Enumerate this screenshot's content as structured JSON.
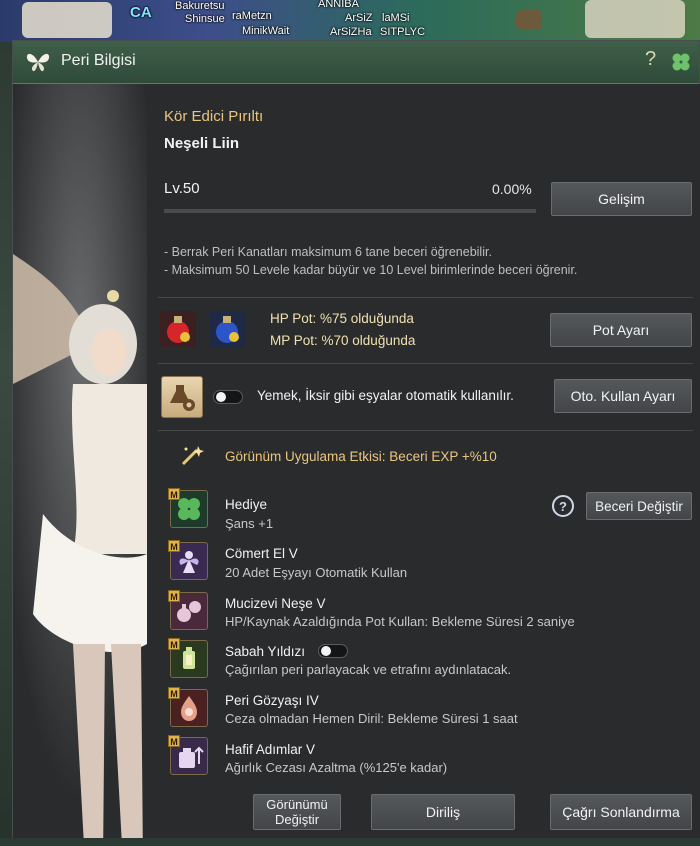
{
  "background": {
    "player_tags": [
      "Bakuretsu",
      "Shinsue",
      "raMetzn",
      "ANNIBA",
      "ArSiZ",
      "laMSi",
      "MinikWait",
      "ArSiZHa",
      "SITPLYC"
    ],
    "guild_tag": "CA"
  },
  "window": {
    "title": "Peri Bilgisi",
    "help_label": "?"
  },
  "peri": {
    "skill_name": "Kör Edici Pırıltı",
    "name": "Neşeli Liin",
    "level": "Lv.50",
    "progress_text": "0.00%",
    "progress_fraction": 0.0,
    "develop_button": "Gelişim"
  },
  "info_lines": [
    "- Berrak Peri Kanatları maksimum 6 tane beceri öğrenebilir.",
    "- Maksimum 50 Levele kadar büyür ve 10 Level birimlerinde beceri öğrenir."
  ],
  "potions": {
    "hp_text": "HP Pot: %75 olduğunda",
    "mp_text": "MP Pot: %70 olduğunda",
    "button": "Pot Ayarı",
    "hp_icon": "hp-potion-icon",
    "mp_icon": "mp-potion-icon"
  },
  "auto_use": {
    "text": "Yemek, İksir gibi eşyalar otomatik kullanılır.",
    "enabled": false,
    "button": "Oto. Kullan Ayarı"
  },
  "appearance_effect": "Görünüm Uygulama Etkisi: Beceri EXP +%10",
  "skills": [
    {
      "badge": "M",
      "title": "Hediye",
      "desc": "Şans +1",
      "icon": "clover-icon"
    },
    {
      "badge": "M",
      "title": "Cömert El V",
      "desc": "20 Adet Eşyayı Otomatik Kullan",
      "icon": "fairy-icon"
    },
    {
      "badge": "M",
      "title": "Mucizevi Neşe V",
      "desc": "HP/Kaynak Azaldığında Pot Kullan: Bekleme Süresi 2 saniye",
      "icon": "potion-swap-icon"
    },
    {
      "badge": "M",
      "title": "Sabah Yıldızı",
      "desc": "Çağırılan peri parlayacak ve etrafını aydınlatacak.",
      "icon": "lantern-icon",
      "toggle_enabled": false
    },
    {
      "badge": "M",
      "title": "Peri Gözyaşı IV",
      "desc": "Ceza olmadan Hemen Diril: Bekleme Süresi 1 saat",
      "icon": "tear-potion-icon"
    },
    {
      "badge": "M",
      "title": "Hafif Adımlar V",
      "desc": "Ağırlık Cezası Azaltma (%125'e kadar)",
      "icon": "weight-icon"
    }
  ],
  "skill_help": "?",
  "change_skill_button": "Beceri Değiştir",
  "footer": {
    "appearance_button": "Görünümü Değiştir",
    "revive_button": "Diriliş",
    "end_summon_button": "Çağrı Sonlandırma"
  }
}
